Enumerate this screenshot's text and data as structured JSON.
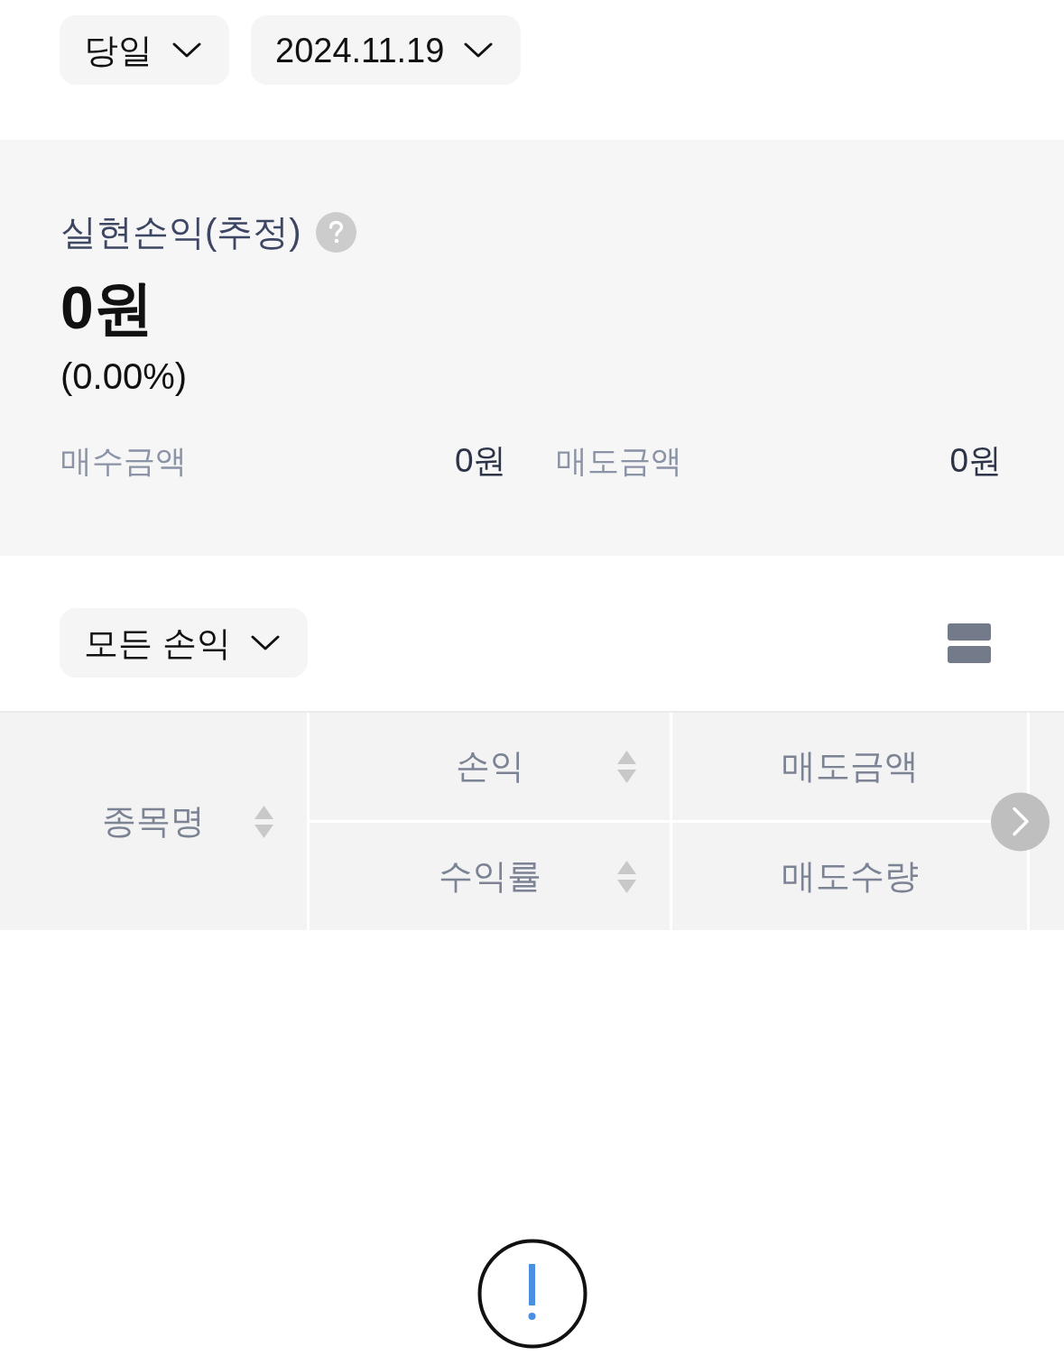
{
  "period_filters": [
    {
      "label": "당일"
    },
    {
      "label": "2024.11.19"
    }
  ],
  "summary": {
    "title": "실현손익(추정)",
    "amount": "0원",
    "rate": "(0.00%)",
    "details": [
      {
        "label": "매수금액",
        "value": "0원"
      },
      {
        "label": "매도금액",
        "value": "0원"
      }
    ]
  },
  "profit_filter": {
    "label": "모든 손익"
  },
  "table": {
    "columns": [
      {
        "headers": [
          {
            "label": "종목명",
            "sortable": true
          }
        ]
      },
      {
        "headers": [
          {
            "label": "손익",
            "sortable": true
          },
          {
            "label": "수익률",
            "sortable": true
          }
        ]
      },
      {
        "headers": [
          {
            "label": "매도금액",
            "sortable": false
          },
          {
            "label": "매도수량",
            "sortable": false
          }
        ]
      }
    ]
  }
}
